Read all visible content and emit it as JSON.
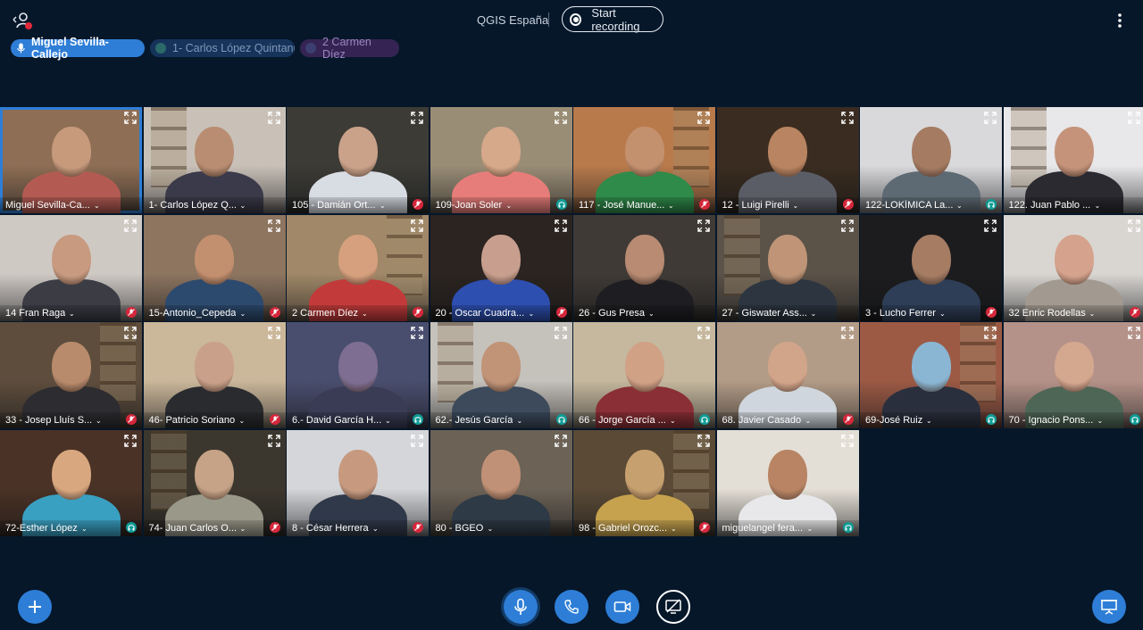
{
  "header": {
    "meeting_title": "QGIS España",
    "record_label": "Start recording"
  },
  "talkers": [
    {
      "label": "Miguel Sevilla-Callejo"
    },
    {
      "label": "1- Carlos López Quintanilla"
    },
    {
      "label": "2 Carmen Díez"
    }
  ],
  "participants": [
    {
      "name": "Miguel Sevilla-Ca...",
      "status": "none",
      "bg": "#8e6e55",
      "face": "#c79a7c",
      "shirt": "#b35b52"
    },
    {
      "name": "1- Carlos López Q...",
      "status": "none",
      "bg": "#c9c1b8",
      "face": "#b98d72",
      "shirt": "#3b3a4a"
    },
    {
      "name": "105 - Damián Ort...",
      "status": "muted",
      "bg": "#3c3b36",
      "face": "#caa28a",
      "shirt": "#d8dce3"
    },
    {
      "name": "109-Joan Soler",
      "status": "listen",
      "bg": "#9a8d76",
      "face": "#d6a98a",
      "shirt": "#e77d7a"
    },
    {
      "name": "117 - José Manue...",
      "status": "muted",
      "bg": "#b87a4b",
      "face": "#c4916f",
      "shirt": "#2f8b4a"
    },
    {
      "name": "12 - Luigi Pirelli",
      "status": "muted",
      "bg": "#3a2c20",
      "face": "#b98461",
      "shirt": "#5a5d66"
    },
    {
      "name": "122-LOKÍMICA La...",
      "status": "listen",
      "bg": "#d9d9db",
      "face": "#a57b62",
      "shirt": "#5d6a73"
    },
    {
      "name": "122. Juan Pablo ...",
      "status": "none",
      "bg": "#e8e7e9",
      "face": "#c5937a",
      "shirt": "#2a2a30"
    },
    {
      "name": "14 Fran Raga",
      "status": "muted",
      "bg": "#cfc9c4",
      "face": "#c89a80",
      "shirt": "#3b3c44"
    },
    {
      "name": "15-Antonio_Cepeda",
      "status": "muted",
      "bg": "#8d7560",
      "face": "#c3906f",
      "shirt": "#2c4a6e"
    },
    {
      "name": "2 Carmen Díez",
      "status": "muted",
      "bg": "#a08868",
      "face": "#d6a07e",
      "shirt": "#c23b3a"
    },
    {
      "name": "20 - Oscar Cuadra...",
      "status": "muted",
      "bg": "#2b2420",
      "face": "#c89f8e",
      "shirt": "#2d4fb0"
    },
    {
      "name": "26 - Gus Presa",
      "status": "none",
      "bg": "#3f3a36",
      "face": "#b88b72",
      "shirt": "#1e1e22"
    },
    {
      "name": "27 - Giswater Ass...",
      "status": "none",
      "bg": "#5b5248",
      "face": "#c09577",
      "shirt": "#2c3540"
    },
    {
      "name": "3 - Lucho Ferrer",
      "status": "muted",
      "bg": "#1c1c1e",
      "face": "#a67c63",
      "shirt": "#2e3e57"
    },
    {
      "name": "32 Enric Rodellas",
      "status": "muted",
      "bg": "#d9d6d2",
      "face": "#d5a38d",
      "shirt": "#a29a90"
    },
    {
      "name": "33 - Josep Lluís S...",
      "status": "muted",
      "bg": "#5e4d3d",
      "face": "#b88b6c",
      "shirt": "#2d2c30"
    },
    {
      "name": "46- Patricio Soriano",
      "status": "muted",
      "bg": "#cbb79a",
      "face": "#c9a089",
      "shirt": "#2a2b2f"
    },
    {
      "name": "6.- David García H...",
      "status": "listen",
      "bg": "#4a4e6e",
      "face": "#7e6e92",
      "shirt": "#3a3c55"
    },
    {
      "name": "62.- Jesús García",
      "status": "listen",
      "bg": "#c5c1bb",
      "face": "#c19377",
      "shirt": "#3c4a5c"
    },
    {
      "name": "66 - Jorge García ...",
      "status": "listen",
      "bg": "#c5b89e",
      "face": "#d1a186",
      "shirt": "#8a2f36"
    },
    {
      "name": "68. Javier Casado",
      "status": "muted",
      "bg": "#b39c87",
      "face": "#d1a58a",
      "shirt": "#cfd6dd"
    },
    {
      "name": "69-José Ruiz",
      "status": "listen",
      "bg": "#9c5a45",
      "face": "#8ab6d4",
      "shirt": "#2a2f3d"
    },
    {
      "name": "70 - Ignacio Pons...",
      "status": "listen",
      "bg": "#b49289",
      "face": "#d4a78f",
      "shirt": "#4e6655"
    },
    {
      "name": "72-Esther López",
      "status": "listen",
      "bg": "#4a3226",
      "face": "#d8a77f",
      "shirt": "#3aa0c2"
    },
    {
      "name": "74- Juan Carlos O...",
      "status": "muted",
      "bg": "#3c372e",
      "face": "#c6a387",
      "shirt": "#9a9889"
    },
    {
      "name": "8 - César Herrera",
      "status": "muted",
      "bg": "#d5d6d9",
      "face": "#c79a80",
      "shirt": "#30394a"
    },
    {
      "name": "80 - BGEO",
      "status": "none",
      "bg": "#6c6256",
      "face": "#c09176",
      "shirt": "#2e3a46"
    },
    {
      "name": "98 - Gabriel Orozc...",
      "status": "muted",
      "bg": "#5a4a36",
      "face": "#c7a06f",
      "shirt": "#c6a24e"
    },
    {
      "name": "miguelangel fera...",
      "status": "listen",
      "bg": "#e4dfd6",
      "face": "#b88463",
      "shirt": "#e8e8ea"
    }
  ],
  "colors": {
    "background": "#06172a",
    "accent": "#2e7ed7",
    "muted": "#d5273b",
    "listen_only": "#0e9c95"
  },
  "icons": {
    "user": "user-icon",
    "record": "record-icon",
    "more": "more-options-icon",
    "expand": "expand-icon",
    "add": "plus-icon",
    "mic": "microphone-icon",
    "phone": "phone-icon",
    "camera": "camera-icon",
    "screenshare": "screen-share-icon",
    "presentation": "presentation-icon"
  }
}
